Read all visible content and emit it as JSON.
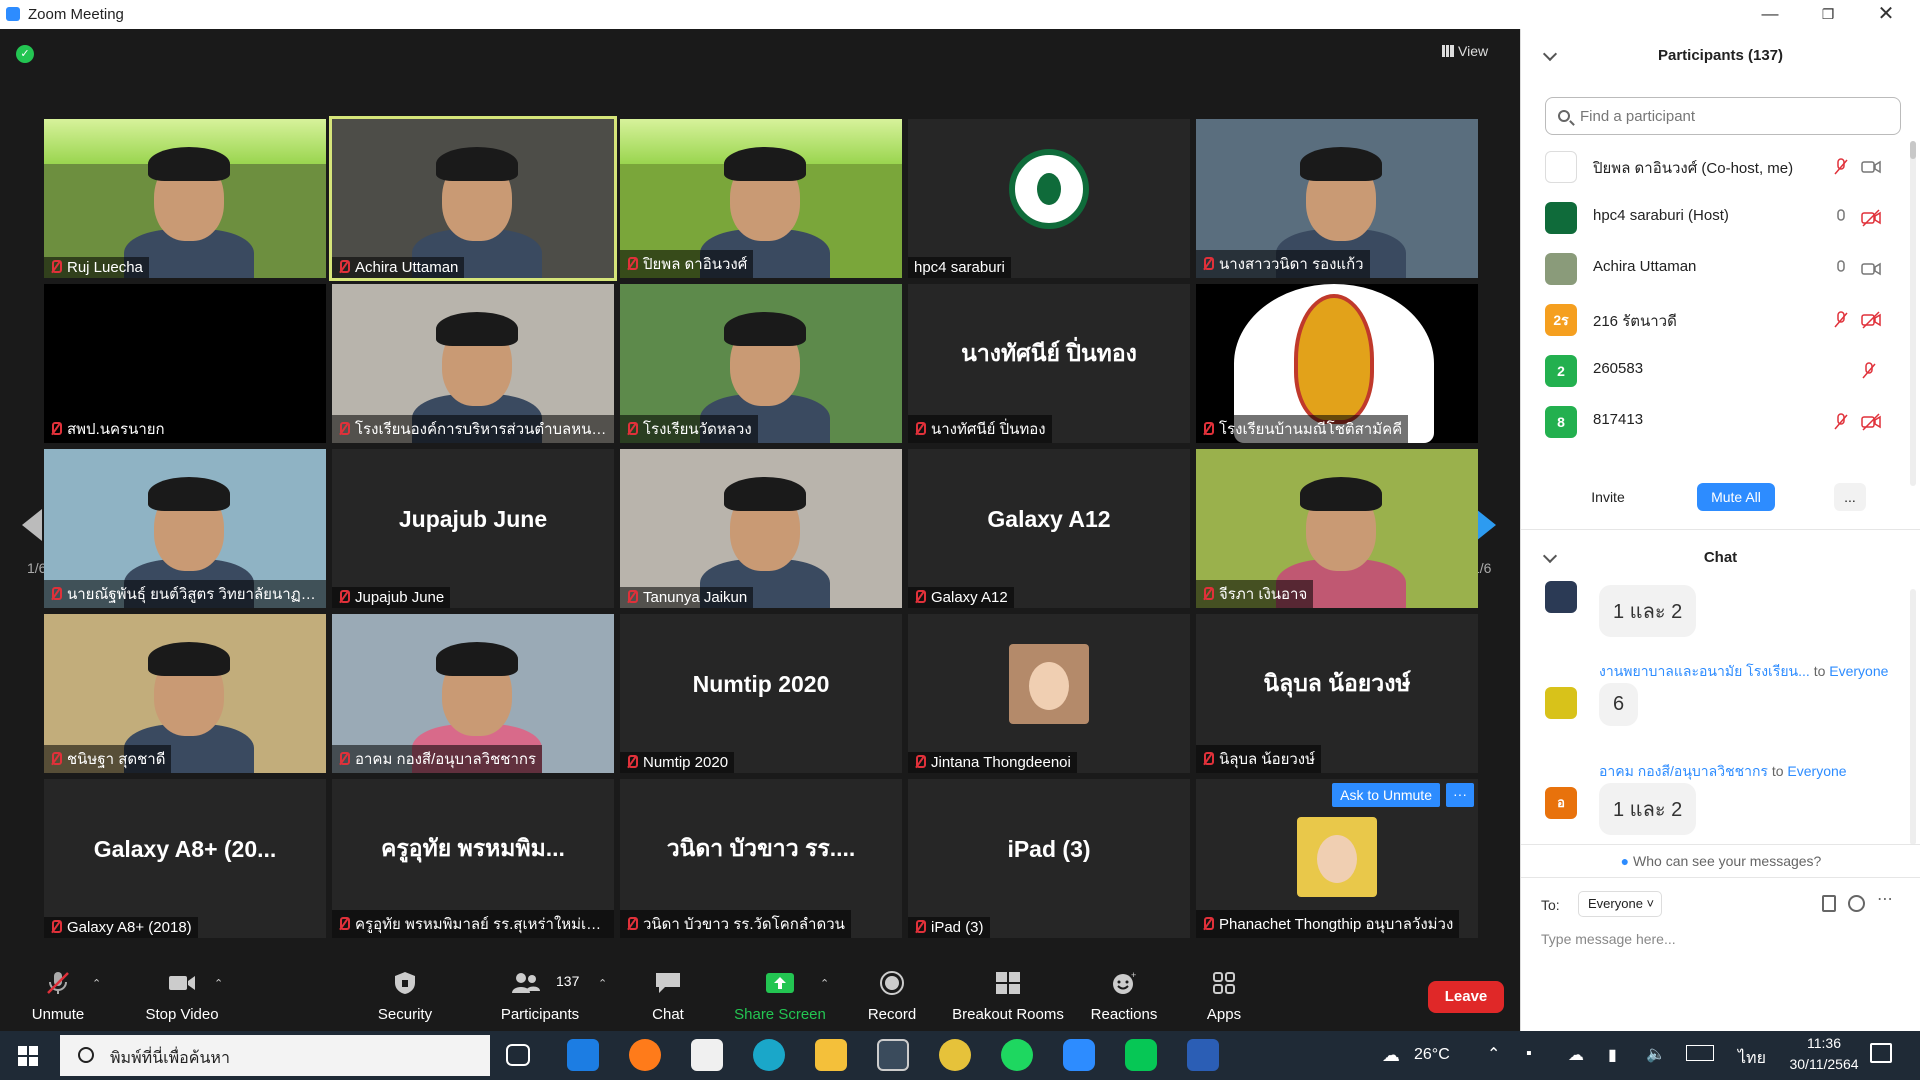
{
  "window": {
    "title": "Zoom Meeting"
  },
  "stage": {
    "view_label": "View",
    "page_indicator_left": "1/6",
    "page_indicator_right": "1/6",
    "ask_to_unmute": "Ask to Unmute",
    "more_label": "···",
    "tiles": [
      {
        "name": "Ruj Luecha",
        "kind": "video"
      },
      {
        "name": "Achira Uttaman",
        "kind": "video"
      },
      {
        "name": "ปิยพล ดาอินวงศ์",
        "kind": "video"
      },
      {
        "name": "hpc4 saraburi",
        "kind": "logo"
      },
      {
        "name": "นางสาววนิดา รองแก้ว",
        "kind": "video"
      },
      {
        "name": "สพป.นครนายก",
        "kind": "blank"
      },
      {
        "name": "โรงเรียนองค์การบริหารส่วนตำบลหนองปล...",
        "kind": "video"
      },
      {
        "name": "โรงเรียนวัดหลวง",
        "kind": "video"
      },
      {
        "name": "นางทัศนีย์ ปิ่นทอง",
        "kind": "text",
        "display": "นางทัศนีย์ ปิ่นทอง"
      },
      {
        "name": "โรงเรียนบ้านมณีโชติสามัคคี",
        "kind": "emblem"
      },
      {
        "name": "นายณัฐพันธุ์ ยนต์วิสูตร วิทยาลัยนาฏศิ...",
        "kind": "video"
      },
      {
        "name": "Jupajub June",
        "kind": "text",
        "display": "Jupajub June"
      },
      {
        "name": "Tanunya Jaikun",
        "kind": "video"
      },
      {
        "name": "Galaxy A12",
        "kind": "text",
        "display": "Galaxy A12"
      },
      {
        "name": "จีรภา เงินอาจ",
        "kind": "video"
      },
      {
        "name": "ชนิษฐา สุดชาดี",
        "kind": "video"
      },
      {
        "name": "อาคม กองสี/อนุบาลวิชชากร",
        "kind": "video"
      },
      {
        "name": "Numtip 2020",
        "kind": "text",
        "display": "Numtip 2020"
      },
      {
        "name": "Jintana Thongdeenoi",
        "kind": "avatar"
      },
      {
        "name": "นิลุบล น้อยวงษ์",
        "kind": "text",
        "display": "นิลุบล น้อยวงษ์"
      },
      {
        "name": "Galaxy A8+ (2018)",
        "kind": "text",
        "display": "Galaxy A8+ (20..."
      },
      {
        "name": "ครูอุทัย พรหมพิมาลย์ รร.สุเหร่าใหม่เจริญ",
        "kind": "text",
        "display": "ครูอุทัย  พรหมพิม..."
      },
      {
        "name": "วนิดา บัวขาว รร.วัดโคกลำดวน",
        "kind": "text",
        "display": "วนิดา บัวขาว รร...."
      },
      {
        "name": "iPad (3)",
        "kind": "text",
        "display": "iPad (3)"
      },
      {
        "name": "Phanachet Thongthip อนุบาลวังม่วง",
        "kind": "avatar2"
      }
    ]
  },
  "controls": {
    "unmute": "Unmute",
    "stop_video": "Stop Video",
    "security": "Security",
    "participants": "Participants",
    "participant_count": "137",
    "chat": "Chat",
    "share_screen": "Share Screen",
    "record": "Record",
    "breakout_rooms": "Breakout Rooms",
    "reactions": "Reactions",
    "apps": "Apps",
    "leave": "Leave"
  },
  "participants_panel": {
    "title": "Participants (137)",
    "search_placeholder": "Find a participant",
    "invite": "Invite",
    "mute_all": "Mute All",
    "more": "...",
    "list": [
      {
        "name": "ปิยพล ดาอินวงศ์ (Co-host, me)",
        "avatar": "",
        "color": "#ffffff"
      },
      {
        "name": "hpc4 saraburi (Host)",
        "avatar": "",
        "color": "#0f6b3a"
      },
      {
        "name": "Achira Uttaman",
        "avatar": "",
        "color": "#8a9b7a"
      },
      {
        "name": "216 รัตนาวดี",
        "avatar": "2ร",
        "color": "#f59f1f"
      },
      {
        "name": "260583",
        "avatar": "2",
        "color": "#23b04f"
      },
      {
        "name": "817413",
        "avatar": "8",
        "color": "#23b04f"
      }
    ]
  },
  "chat_panel": {
    "title": "Chat",
    "messages": [
      {
        "sender": "",
        "to": "",
        "text": "1 และ 2",
        "avatar": "",
        "color": "#2b3a55"
      },
      {
        "sender": "งานพยาบาลและอนามัย โรงเรียน...",
        "to_label": "to",
        "to": "Everyone",
        "text": "6",
        "avatar": "",
        "color": "#d8c21a"
      },
      {
        "sender": "อาคม กองสี/อนุบาลวิชชากร",
        "to_label": "to",
        "to": "Everyone",
        "text": "1 และ 2",
        "avatar": "อ",
        "color": "#e8720c"
      }
    ],
    "who_can_see": "Who can see your messages?",
    "to_label": "To:",
    "to_value": "Everyone",
    "input_placeholder": "Type message here..."
  },
  "taskbar": {
    "search_placeholder": "พิมพ์ที่นี่เพื่อค้นหา",
    "weather": "26°C",
    "language": "ไทย",
    "time": "11:36",
    "date": "30/11/2564"
  },
  "colors": {
    "accent": "#2d8cff",
    "leave": "#e02828",
    "share": "#23c552",
    "mic_off": "#e0313a"
  }
}
